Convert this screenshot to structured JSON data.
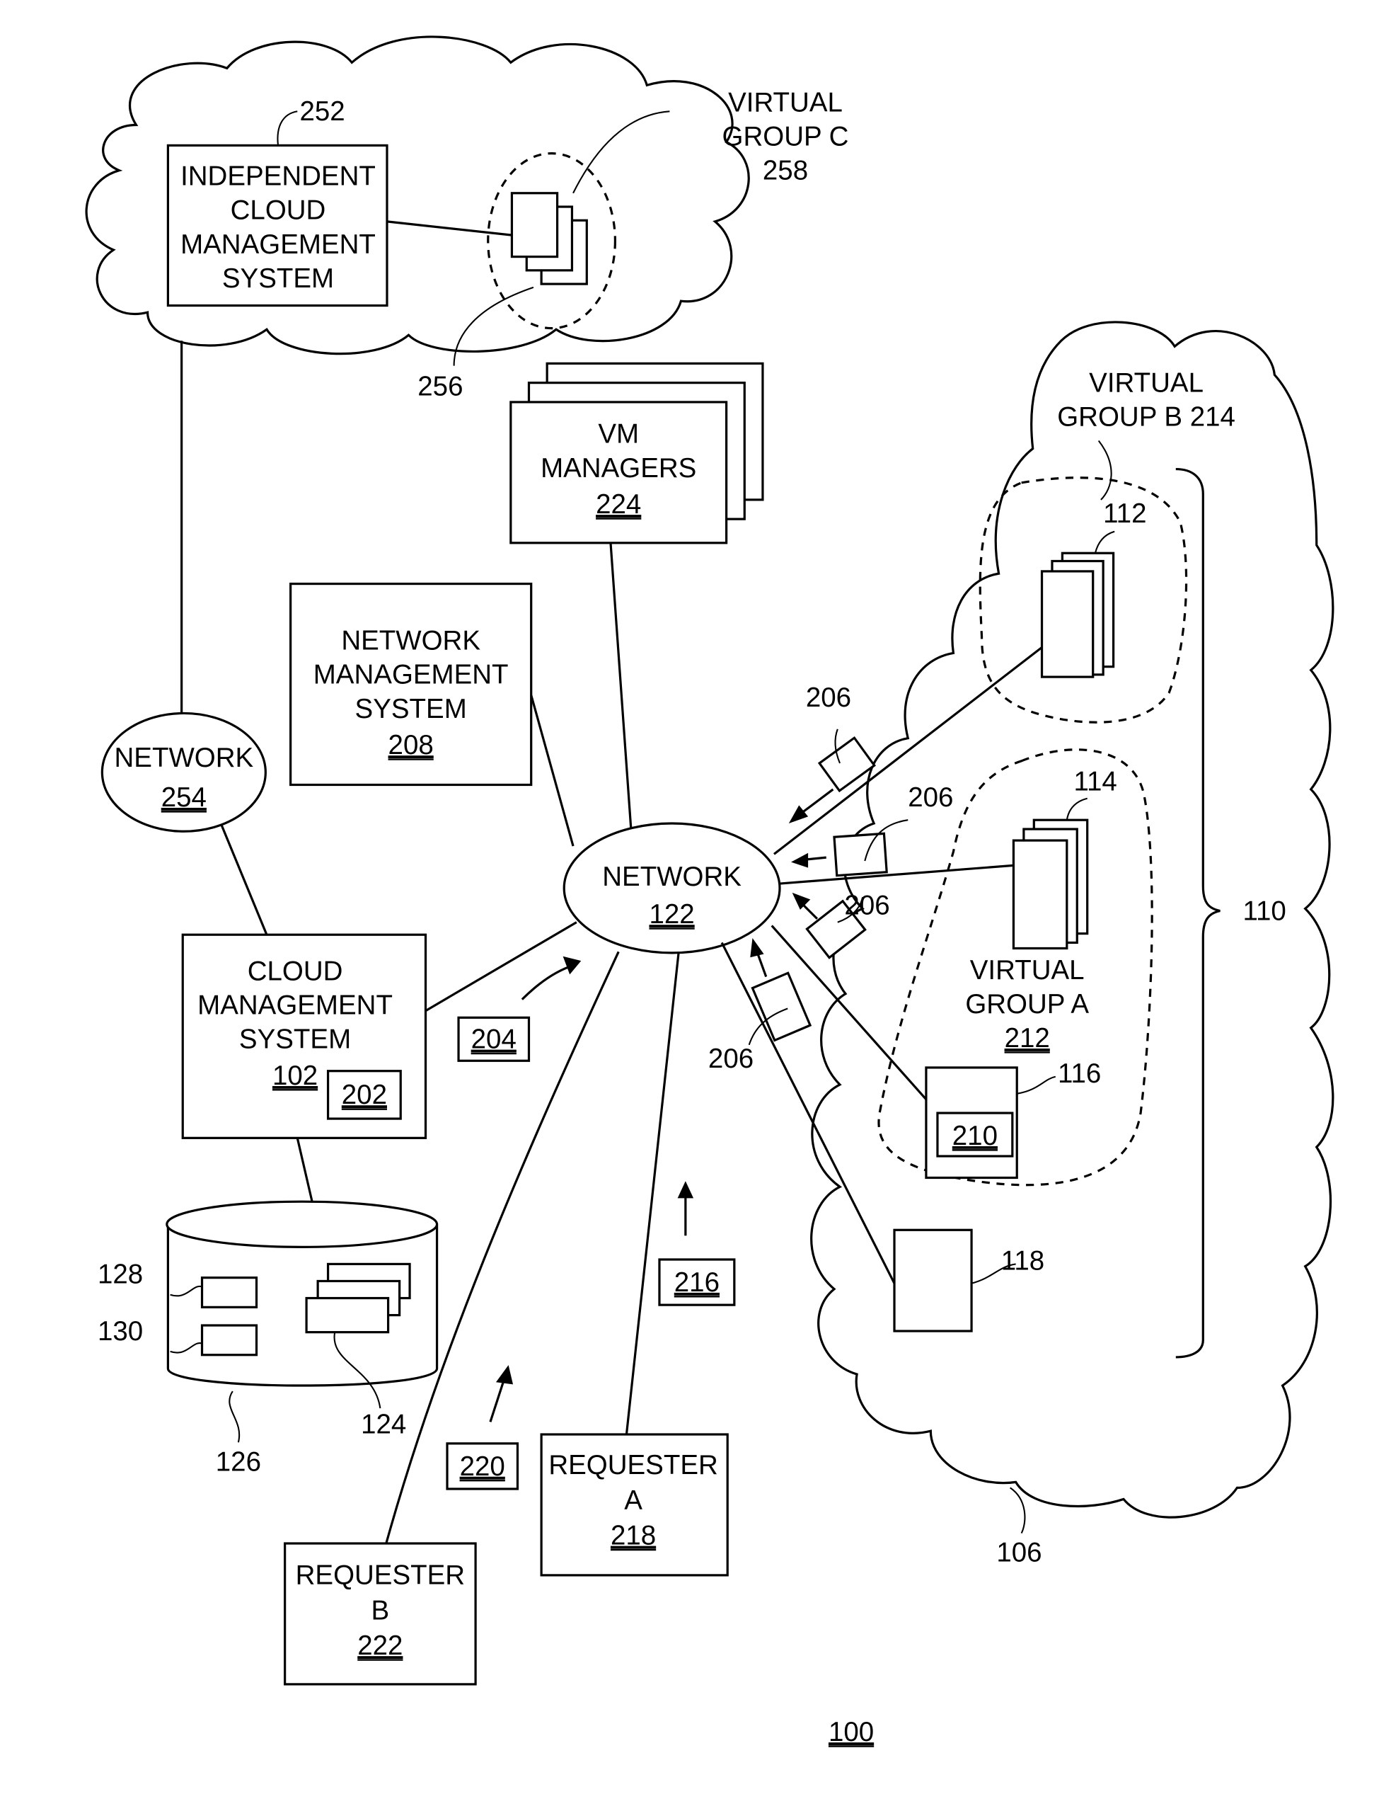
{
  "figure_number": "100",
  "independent_cloud": {
    "ref": "252",
    "box_lines": [
      "INDEPENDENT",
      "CLOUD",
      "MANAGEMENT",
      "SYSTEM"
    ],
    "virtual_group_c_lines": [
      "VIRTUAL",
      "GROUP C",
      "258"
    ],
    "vm_ref": "256"
  },
  "network_254": {
    "lines": [
      "NETWORK"
    ],
    "ref": "254"
  },
  "vm_managers": {
    "lines": [
      "VM",
      "MANAGERS"
    ],
    "ref": "224"
  },
  "network_mgmt": {
    "lines": [
      "NETWORK",
      "MANAGEMENT",
      "SYSTEM"
    ],
    "ref": "208"
  },
  "network_122": {
    "lines": [
      "NETWORK"
    ],
    "ref": "122"
  },
  "cloud_mgmt": {
    "lines": [
      "CLOUD",
      "MANAGEMENT",
      "SYSTEM"
    ],
    "ref": "102",
    "inner_ref": "202"
  },
  "message_204": "204",
  "message_216": "216",
  "message_220": "220",
  "database": {
    "ref": "126",
    "item_refs": [
      "128",
      "130"
    ],
    "stack_ref": "124"
  },
  "requester_a": {
    "lines": [
      "REQUESTER",
      "A"
    ],
    "ref": "218"
  },
  "requester_b": {
    "lines": [
      "REQUESTER",
      "B"
    ],
    "ref": "222"
  },
  "cloud_106": {
    "ref": "106",
    "bracket_ref": "110",
    "virtual_group_b_lines": [
      "VIRTUAL",
      "GROUP B 214"
    ],
    "host_112": "112",
    "host_114": "114",
    "virtual_group_a_lines": [
      "VIRTUAL",
      "GROUP A"
    ],
    "virtual_group_a_ref": "212",
    "host_116": "116",
    "inner_210": "210",
    "host_118": "118"
  },
  "packets": [
    "206",
    "206",
    "206",
    "206"
  ]
}
